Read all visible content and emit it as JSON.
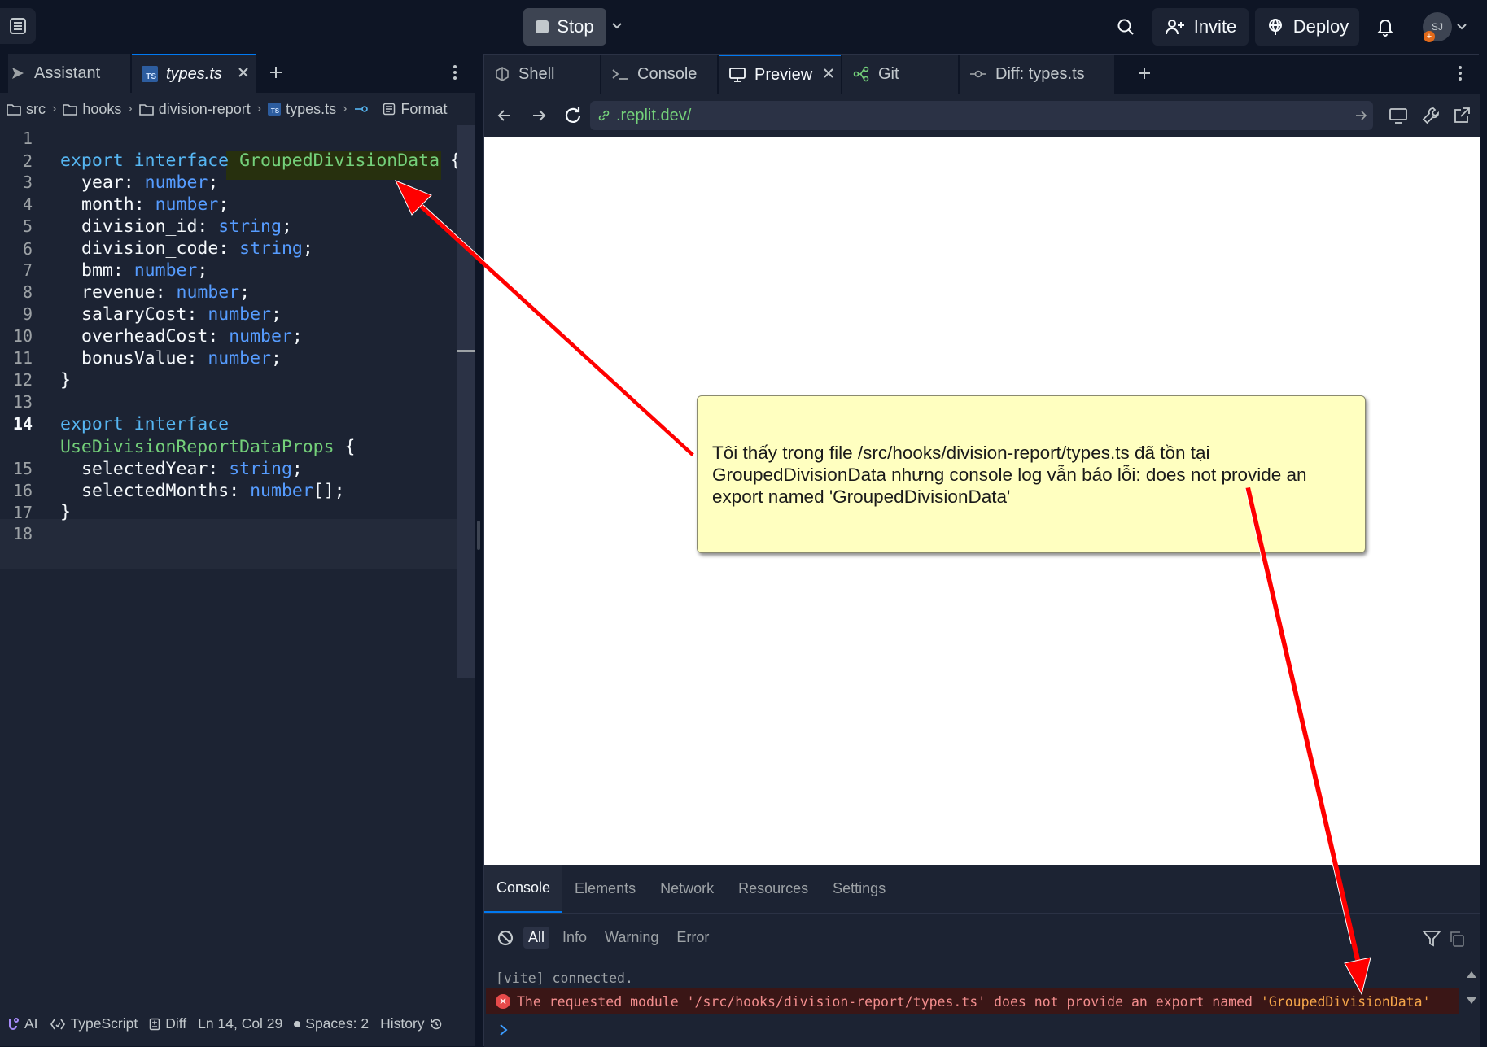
{
  "topbar": {
    "stop_label": "Stop",
    "invite_label": "Invite",
    "deploy_label": "Deploy",
    "avatar_initials": "SJ",
    "avatar_badge": "+"
  },
  "left_tabs": {
    "assistant_label": "Assistant",
    "file_label": "types.ts",
    "file_badge": "TS"
  },
  "breadcrumb": {
    "items": [
      "src",
      "hooks",
      "division-report",
      "types.ts"
    ],
    "format_label": "Format"
  },
  "editor": {
    "line_numbers": [
      "1",
      "2",
      "3",
      "4",
      "5",
      "6",
      "7",
      "8",
      "9",
      "10",
      "11",
      "12",
      "13",
      "14",
      "15",
      "16",
      "17",
      "18"
    ],
    "active_line": "14",
    "tokens": {
      "export": "export",
      "interface": "interface",
      "name1": "GroupedDivisionData",
      "name2": "UseDivisionReportDataProps",
      "open_brace": "{",
      "close_brace": "}",
      "number": "number",
      "string": "string",
      "number_array": "number",
      "array_suffix": "[];",
      "semicolon": ";"
    },
    "fields1": [
      {
        "name": "year: ",
        "type": "number"
      },
      {
        "name": "month: ",
        "type": "number"
      },
      {
        "name": "division_id: ",
        "type": "string"
      },
      {
        "name": "division_code: ",
        "type": "string"
      },
      {
        "name": "bmm: ",
        "type": "number"
      },
      {
        "name": "revenue: ",
        "type": "number"
      },
      {
        "name": "salaryCost: ",
        "type": "number"
      },
      {
        "name": "overheadCost: ",
        "type": "number"
      },
      {
        "name": "bonusValue: ",
        "type": "number"
      }
    ],
    "fields2": [
      {
        "name": "selectedYear: ",
        "type": "string"
      },
      {
        "name": "selectedMonths: ",
        "type": "number"
      }
    ]
  },
  "statusbar": {
    "ai": "AI",
    "language": "TypeScript",
    "diff": "Diff",
    "position": "Ln 14, Col 29",
    "spaces": "Spaces: 2",
    "history": "History"
  },
  "right_tabs": {
    "shell": "Shell",
    "console": "Console",
    "preview": "Preview",
    "git": "Git",
    "diff": "Diff: types.ts"
  },
  "preview": {
    "url": ".replit.dev/",
    "annotation": "Tôi thấy trong file /src/hooks/division-report/types.ts đã tồn tại GroupedDivisionData nhưng console log vẫn báo lỗi: does not provide an export named 'GroupedDivisionData'"
  },
  "devtools": {
    "tabs": [
      "Console",
      "Elements",
      "Network",
      "Resources",
      "Settings"
    ],
    "levels": [
      "All",
      "Info",
      "Warning",
      "Error"
    ],
    "log_vite": "[vite] connected.",
    "error_prefix": "The requested module '/src/hooks/division-report/types.ts' does not provide an export named ",
    "error_name": "'GroupedDivisionData'",
    "error_icon": "✕"
  },
  "colors": {
    "bg": "#0e1525",
    "panel": "#1c2333",
    "accent": "#0079f2",
    "keyword": "#56b6f2",
    "type": "#569cff",
    "identifier": "#74d07a",
    "annotation_bg": "#ffffc0",
    "arrow": "#ff0000"
  }
}
